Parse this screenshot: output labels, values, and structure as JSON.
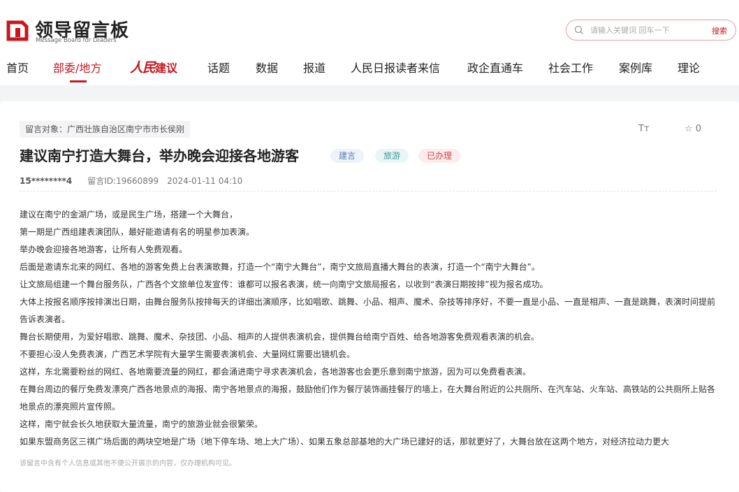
{
  "brand": {
    "title": "领导留言板",
    "subtitle": "Message Board for Leaders",
    "accent": "#c8161e"
  },
  "search": {
    "placeholder": "请输入关键词 回车一下",
    "button": "搜索"
  },
  "nav": {
    "items": [
      "首页",
      "部委/地方",
      "话题",
      "数据",
      "报道",
      "人民日报读者来信",
      "政企直通车",
      "社会工作",
      "案例库",
      "理论"
    ],
    "active": "部委/地方",
    "special": {
      "script": "人民",
      "text": "建议"
    }
  },
  "message": {
    "target": "留言对象：广西壮族自治区南宁市市长侯刚",
    "title": "建议南宁打造大舞台，举办晚会迎接各地游客",
    "tags": [
      "建言",
      "旅游",
      "已办理"
    ],
    "user": "15********4",
    "id": "留言ID:19660899",
    "time": "2024-01-11 04:10",
    "font_size_icon": "Tт",
    "favorite_count": "☆ 0",
    "paragraphs": [
      "建议在南宁的金湖广场，或是民生广场，搭建一个大舞台，",
      "第一期是广西组建表演团队，最好能邀请有名的明星参加表演。",
      "举办晚会迎接各地游客，让所有人免费观看。",
      "后面是邀请东北来的网红、各地的游客免费上台表演歌舞，打造一个“南宁大舞台”，南宁文旅局直播大舞台的表演，打造一个“南宁大舞台”。",
      "让文旅局组建一个舞台服务队，广西各个文旅单位发宣传：谁都可以报名表演，统一向南宁文旅局报名，以收到“表演日期按排”视为报名成功。",
      "大体上按报名顺序按排演出日期，由舞台服务队按排每天的详细出演顺序，比如唱歌、跳舞、小品、相声、魔术、杂技等排序好，不要一直是小品、一直是相声、一直是跳舞，表演时间提前告诉表演者。",
      "舞台长期使用，为爱好唱歌、跳舞、魔术、杂技团、小品、相声的人提供表演机会，提供舞台给南宁百姓、给各地游客免费观看表演的机会。",
      "不要担心没人免费表演，广西艺术学院有大量学生需要表演机会、大量网红需要出镜机会。",
      "这样，东北需要粉丝的网红、各地需要流量的网红，都会涌进南宁寻求表演机会，各地游客也会更乐意到南宁旅游，因为可以免费看表演。",
      "在舞台周边的餐厅免费发漂亮广西各地景点的海报、南宁各地景点的海报，鼓励他们作为餐厅装饰画挂餐厅的墙上，在大舞台附近的公共厕所、在汽车站、火车站、高铁站的公共厕所上贴各地景点的漂亮照片宣传照。",
      "这样，南宁就会长久地获取大量流量，南宁的旅游业就会很繁荣。",
      "如果东盟商务区三祺广场后面的两块空地是广场（地下停车场、地上大广场）、如果五象总部基地的大广场已建好的话，那就更好了，大舞台放在这两个地方，对经济拉动力更大"
    ],
    "privacy_notice": "该留言中含有个人信息或其他不便公开展示的内容，仅办理机构可见。"
  }
}
